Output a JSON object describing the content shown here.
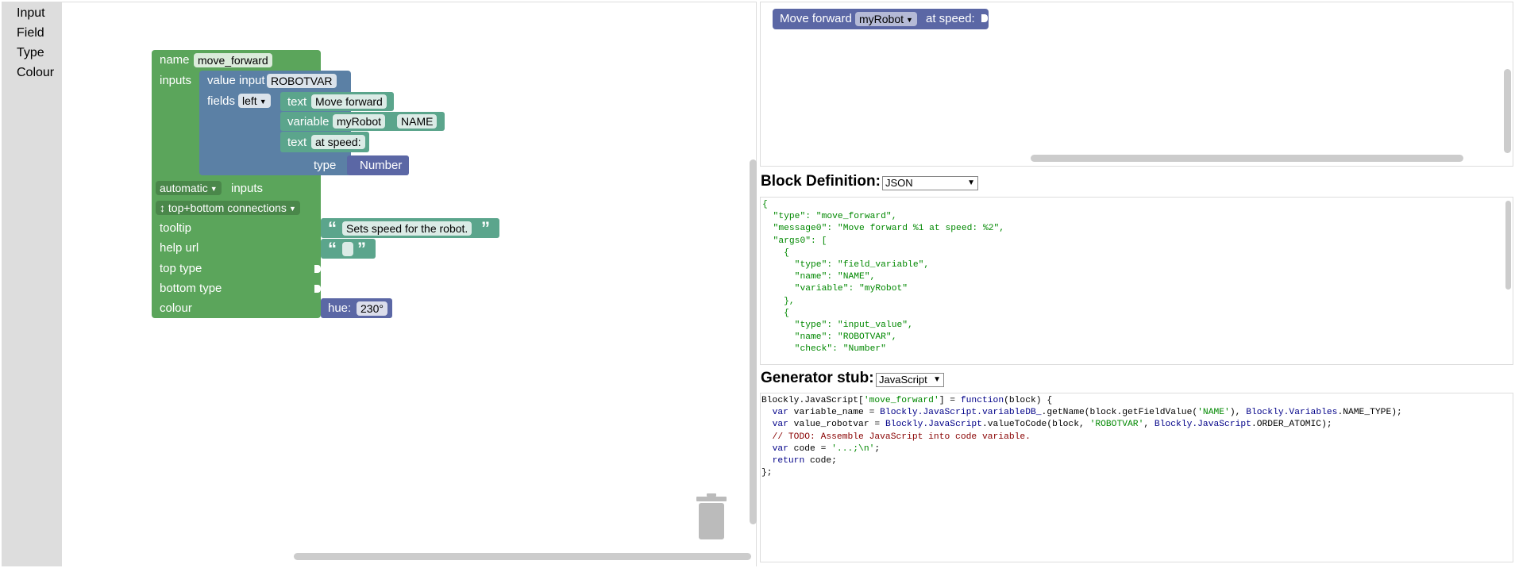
{
  "toolbox": {
    "items": [
      "Input",
      "Field",
      "Type",
      "Colour"
    ]
  },
  "factory_block": {
    "name_label": "name",
    "name_value": "move_forward",
    "inputs_label": "inputs",
    "value_input_label": "value input",
    "value_input_name": "ROBOTVAR",
    "fields_label": "fields",
    "fields_align": "left",
    "text1_label": "text",
    "text1_value": "Move forward",
    "variable_label": "variable",
    "variable_value": "myRobot",
    "variable_name": "NAME",
    "text2_label": "text",
    "text2_value": "at speed:",
    "type_label": "type",
    "type_value": "Number",
    "inputs_mode": "automatic",
    "inputs_mode_suffix": "inputs",
    "connections": "↕ top+bottom connections",
    "tooltip_label": "tooltip",
    "tooltip_value": "Sets speed for the robot.",
    "helpurl_label": "help url",
    "toptype_label": "top type",
    "bottomtype_label": "bottom type",
    "colour_label": "colour",
    "hue_label": "hue:",
    "hue_value": "230°"
  },
  "preview": {
    "label": "Move forward",
    "variable": "myRobot",
    "suffix": "at speed:"
  },
  "block_definition": {
    "title": "Block Definition:",
    "format": "JSON",
    "code": "{\n  \"type\": \"move_forward\",\n  \"message0\": \"Move forward %1 at speed: %2\",\n  \"args0\": [\n    {\n      \"type\": \"field_variable\",\n      \"name\": \"NAME\",\n      \"variable\": \"myRobot\"\n    },\n    {\n      \"type\": \"input_value\",\n      \"name\": \"ROBOTVAR\",\n      \"check\": \"Number\""
  },
  "generator": {
    "title": "Generator stub:",
    "language": "JavaScript",
    "lines": [
      {
        "parts": [
          [
            "pl",
            "Blockly.JavaScript["
          ],
          [
            "st",
            "'move_forward'"
          ],
          [
            "pl",
            "] = "
          ],
          [
            "kw",
            "function"
          ],
          [
            "pl",
            "(block) {"
          ]
        ]
      },
      {
        "parts": [
          [
            "pl",
            "  "
          ],
          [
            "kw",
            "var"
          ],
          [
            "pl",
            " variable_name = "
          ],
          [
            "kw",
            "Blockly.JavaScript.variableDB_"
          ],
          [
            "pl",
            ".getName(block.getFieldValue("
          ],
          [
            "st",
            "'NAME'"
          ],
          [
            "pl",
            "), "
          ],
          [
            "kw",
            "Blockly.Variables"
          ],
          [
            "pl",
            ".NAME_TYPE);"
          ]
        ]
      },
      {
        "parts": [
          [
            "pl",
            "  "
          ],
          [
            "kw",
            "var"
          ],
          [
            "pl",
            " value_robotvar = "
          ],
          [
            "kw",
            "Blockly.JavaScript"
          ],
          [
            "pl",
            ".valueToCode(block, "
          ],
          [
            "st",
            "'ROBOTVAR'"
          ],
          [
            "pl",
            ", "
          ],
          [
            "kw",
            "Blockly.JavaScript"
          ],
          [
            "pl",
            ".ORDER_ATOMIC);"
          ]
        ]
      },
      {
        "parts": [
          [
            "cm",
            "  // TODO: Assemble JavaScript into code variable."
          ]
        ]
      },
      {
        "parts": [
          [
            "pl",
            "  "
          ],
          [
            "kw",
            "var"
          ],
          [
            "pl",
            " code = "
          ],
          [
            "st",
            "'...;\\n'"
          ],
          [
            "pl",
            ";"
          ]
        ]
      },
      {
        "parts": [
          [
            "pl",
            "  "
          ],
          [
            "kw",
            "return"
          ],
          [
            "pl",
            " code;"
          ]
        ]
      },
      {
        "parts": [
          [
            "pl",
            "};"
          ]
        ]
      }
    ]
  }
}
